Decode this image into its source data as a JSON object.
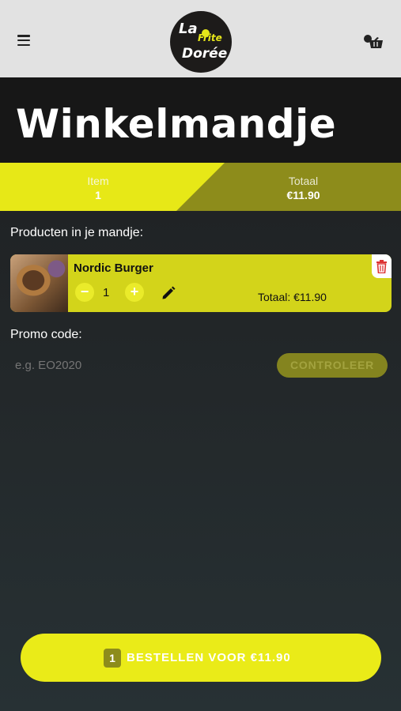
{
  "header": {
    "menu_icon": "hamburger-menu-icon",
    "logo": {
      "line1": "La",
      "line2": "Frite",
      "line3": "Dorée"
    },
    "cart_icon": "shopping-basket-icon"
  },
  "page": {
    "title": "Winkelmandje"
  },
  "summary": {
    "item_label": "Item",
    "item_count": "1",
    "total_label": "Totaal",
    "total_value": "€11.90",
    "colors": {
      "accent": "#e7e817",
      "accent_dark": "#8d8c1b"
    }
  },
  "cart": {
    "section_label": "Producten in je mandje:",
    "items": [
      {
        "name": "Nordic Burger",
        "quantity": "1",
        "minus_label": "−",
        "plus_label": "+",
        "total": "Totaal: €11.90",
        "edit_icon": "pencil-icon",
        "delete_icon": "trash-icon"
      }
    ]
  },
  "promo": {
    "label": "Promo code:",
    "placeholder": "e.g. EO2020",
    "button_label": "CONTROLEER"
  },
  "order": {
    "count": "1",
    "label": "BESTELLEN VOOR €11.90"
  }
}
